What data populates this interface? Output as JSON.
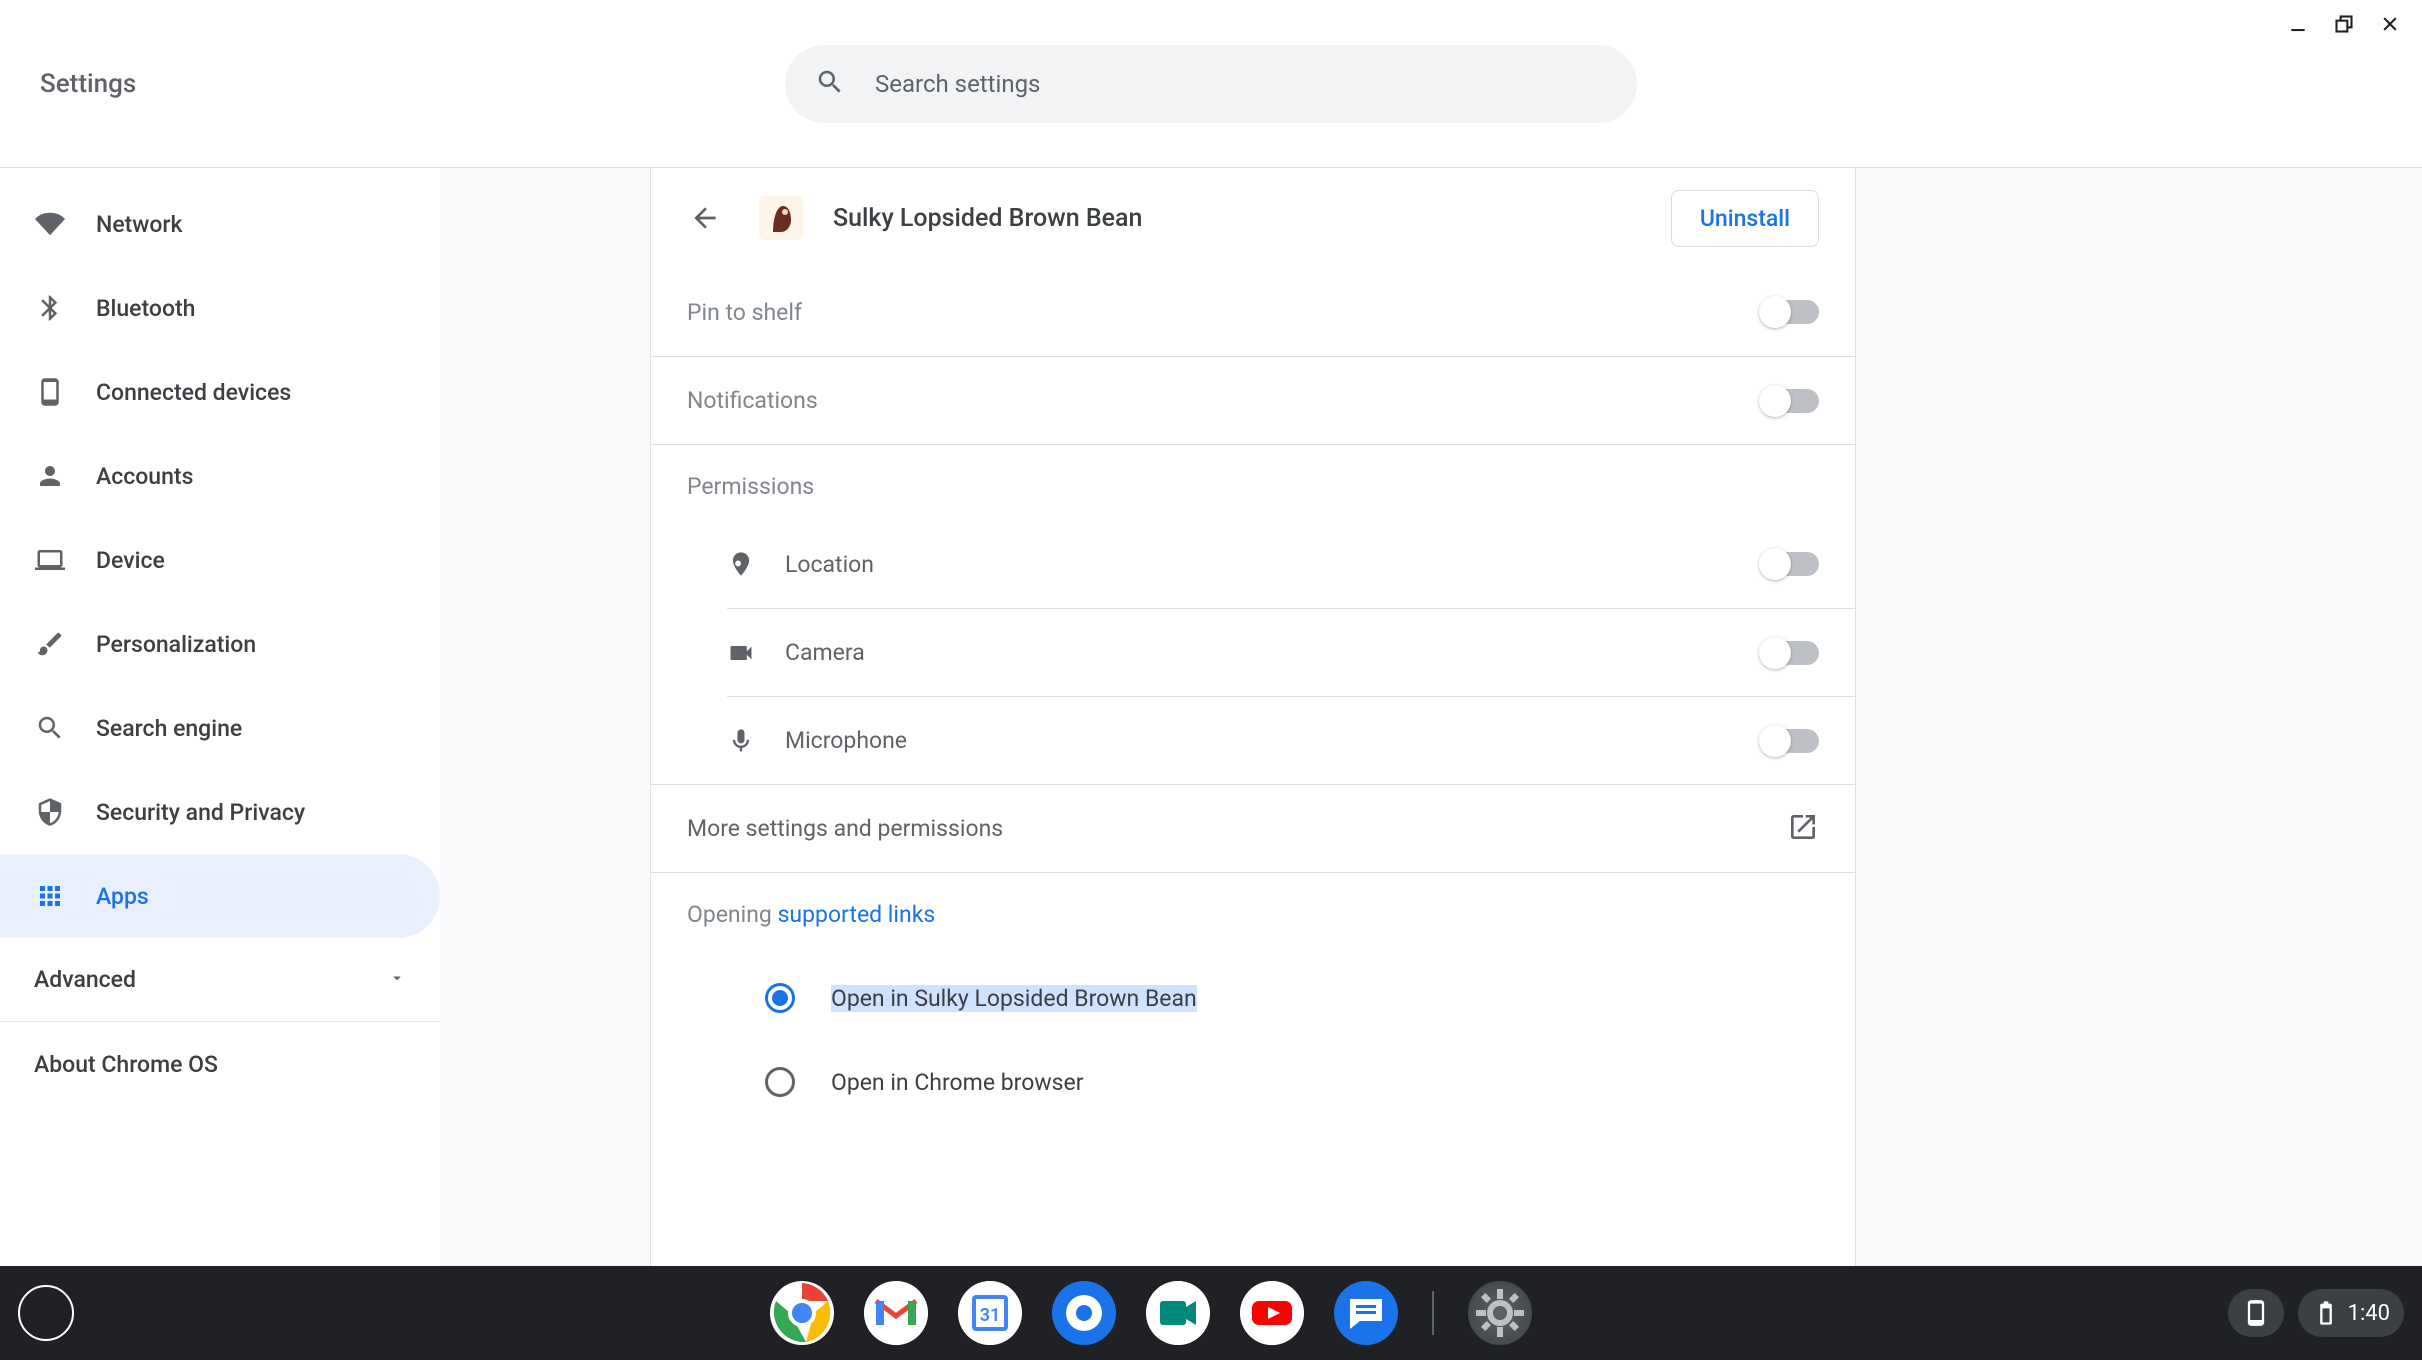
{
  "window_controls": {
    "minimize": "minimize",
    "maximize": "maximize",
    "close": "close"
  },
  "header": {
    "title": "Settings",
    "search_placeholder": "Search settings"
  },
  "sidebar": {
    "items": [
      {
        "label": "Network",
        "icon": "wifi"
      },
      {
        "label": "Bluetooth",
        "icon": "bluetooth"
      },
      {
        "label": "Connected devices",
        "icon": "phone"
      },
      {
        "label": "Accounts",
        "icon": "person"
      },
      {
        "label": "Device",
        "icon": "laptop"
      },
      {
        "label": "Personalization",
        "icon": "brush"
      },
      {
        "label": "Search engine",
        "icon": "search"
      },
      {
        "label": "Security and Privacy",
        "icon": "shield"
      },
      {
        "label": "Apps",
        "icon": "grid",
        "active": true
      }
    ],
    "advanced_label": "Advanced",
    "about_label": "About Chrome OS"
  },
  "app": {
    "name": "Sulky Lopsided Brown Bean",
    "uninstall": "Uninstall",
    "pin_to_shelf": "Pin to shelf",
    "notifications": "Notifications",
    "permissions_header": "Permissions",
    "permissions": {
      "location": "Location",
      "camera": "Camera",
      "microphone": "Microphone"
    },
    "more_settings": "More settings and permissions",
    "opening_prefix": "Opening ",
    "opening_link": "supported links",
    "radio_open_app": "Open in Sulky Lopsided Brown Bean",
    "radio_open_browser": "Open in Chrome browser"
  },
  "shelf": {
    "apps": [
      "chrome",
      "gmail",
      "calendar",
      "files",
      "meet",
      "youtube",
      "messages",
      "settings"
    ],
    "time": "1:40"
  }
}
